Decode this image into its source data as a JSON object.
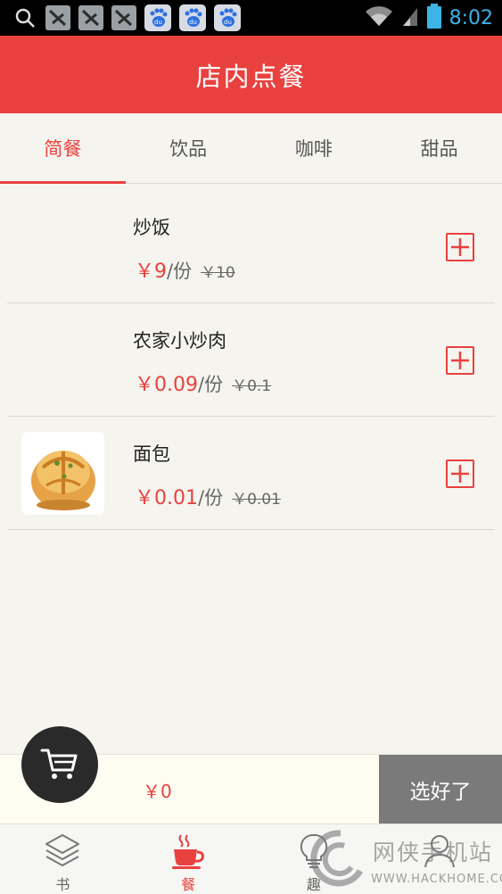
{
  "status_bar": {
    "time": "8:02",
    "icons": [
      "search-icon",
      "app-icon",
      "app-icon",
      "app-icon",
      "baidu-icon",
      "baidu-icon",
      "baidu-icon",
      "wifi-icon",
      "signal-icon",
      "battery-icon"
    ],
    "baidu_text": "du"
  },
  "header": {
    "title": "店内点餐"
  },
  "tabs": [
    {
      "label": "简餐",
      "active": true
    },
    {
      "label": "饮品",
      "active": false
    },
    {
      "label": "咖啡",
      "active": false
    },
    {
      "label": "甜品",
      "active": false
    }
  ],
  "menu": [
    {
      "name": "炒饭",
      "price": "￥9",
      "unit": "/份",
      "original_price": "￥10",
      "has_image": false
    },
    {
      "name": "农家小炒肉",
      "price": "￥0.09",
      "unit": "/份",
      "original_price": "￥0.1",
      "has_image": false
    },
    {
      "name": "面包",
      "price": "￥0.01",
      "unit": "/份",
      "original_price": "￥0.01",
      "has_image": true
    }
  ],
  "cart": {
    "total": "￥0",
    "confirm_label": "选好了"
  },
  "bottom_nav": [
    {
      "label": "书",
      "icon": "layers-icon",
      "active": false
    },
    {
      "label": "餐",
      "icon": "coffee-cup-icon",
      "active": true
    },
    {
      "label": "趣",
      "icon": "lightbulb-icon",
      "active": false
    },
    {
      "label": "",
      "icon": "person-icon",
      "active": false
    }
  ],
  "watermark": {
    "cn": "网侠手机站",
    "en": "WWW.HACKHOME.COM"
  },
  "colors": {
    "accent": "#e9413e",
    "status_time": "#3db3e6",
    "confirm_bg": "#7a7a7a"
  }
}
